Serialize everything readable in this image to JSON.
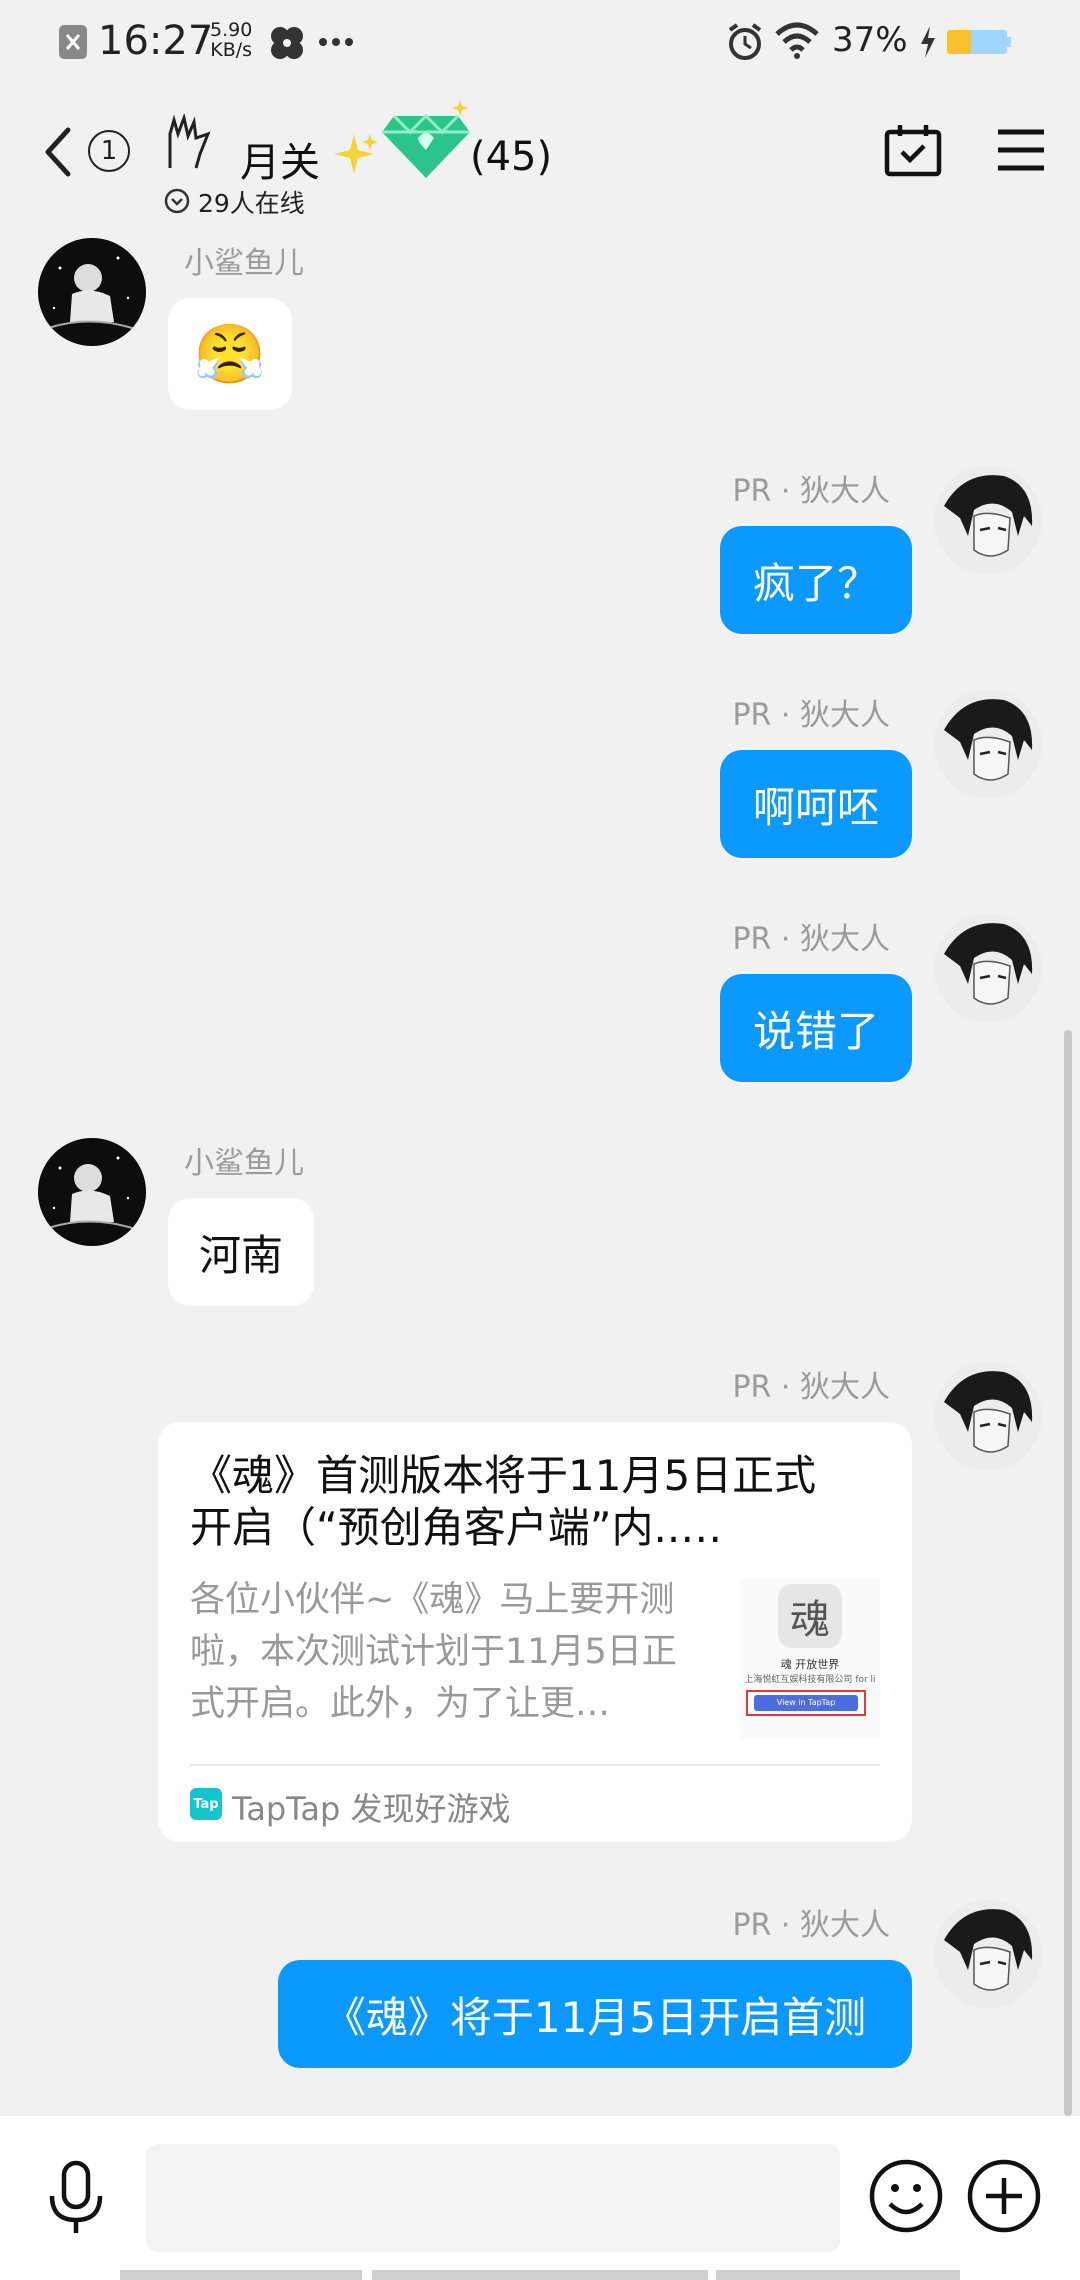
{
  "status_bar": {
    "time": "16:27",
    "net_speed_value": "5.90",
    "net_speed_unit": "KB/s",
    "battery_percent": "37%"
  },
  "header": {
    "unread_count": "1",
    "group_name": "月关",
    "member_count": "(45)",
    "online_status": "29人在线"
  },
  "messages": [
    {
      "sender": "小鲨鱼儿",
      "type": "emoji",
      "content": "😤"
    },
    {
      "sender": "PR · 狄大人",
      "type": "text",
      "content": "疯了？"
    },
    {
      "sender": "PR · 狄大人",
      "type": "text",
      "content": "啊呵呸"
    },
    {
      "sender": "PR · 狄大人",
      "type": "text",
      "content": "说错了"
    },
    {
      "sender": "小鲨鱼儿",
      "type": "text",
      "content": "河南"
    },
    {
      "sender": "PR · 狄大人",
      "type": "card"
    },
    {
      "sender": "PR · 狄大人",
      "type": "text",
      "content": "《魂》将于11月5日开启首测"
    }
  ],
  "card": {
    "title_line1": "《魂》首测版本将于11月5日正式",
    "title_line2": "开启（“预创角客户端”内..…",
    "desc_line1": "各位小伙伴~《魂》马上要开测",
    "desc_line2": "啦，本次测试计划于11月5日正",
    "desc_line3": "式开启。此外，为了让更…",
    "thumb_text1": "魂 开放世界",
    "thumb_text2": "上海悦虹互娱科技有限公司",
    "thumb_text3": "for li",
    "thumb_button": "View in TapTap",
    "source_icon": "Tap",
    "source": "TapTap 发现好游戏"
  },
  "colors": {
    "outgoing_bubble": "#0b99ff",
    "background": "#f1f1f1"
  },
  "icons": [
    "back-icon",
    "calendar-check-icon",
    "menu-icon",
    "microphone-icon",
    "emoji-icon",
    "add-icon"
  ]
}
